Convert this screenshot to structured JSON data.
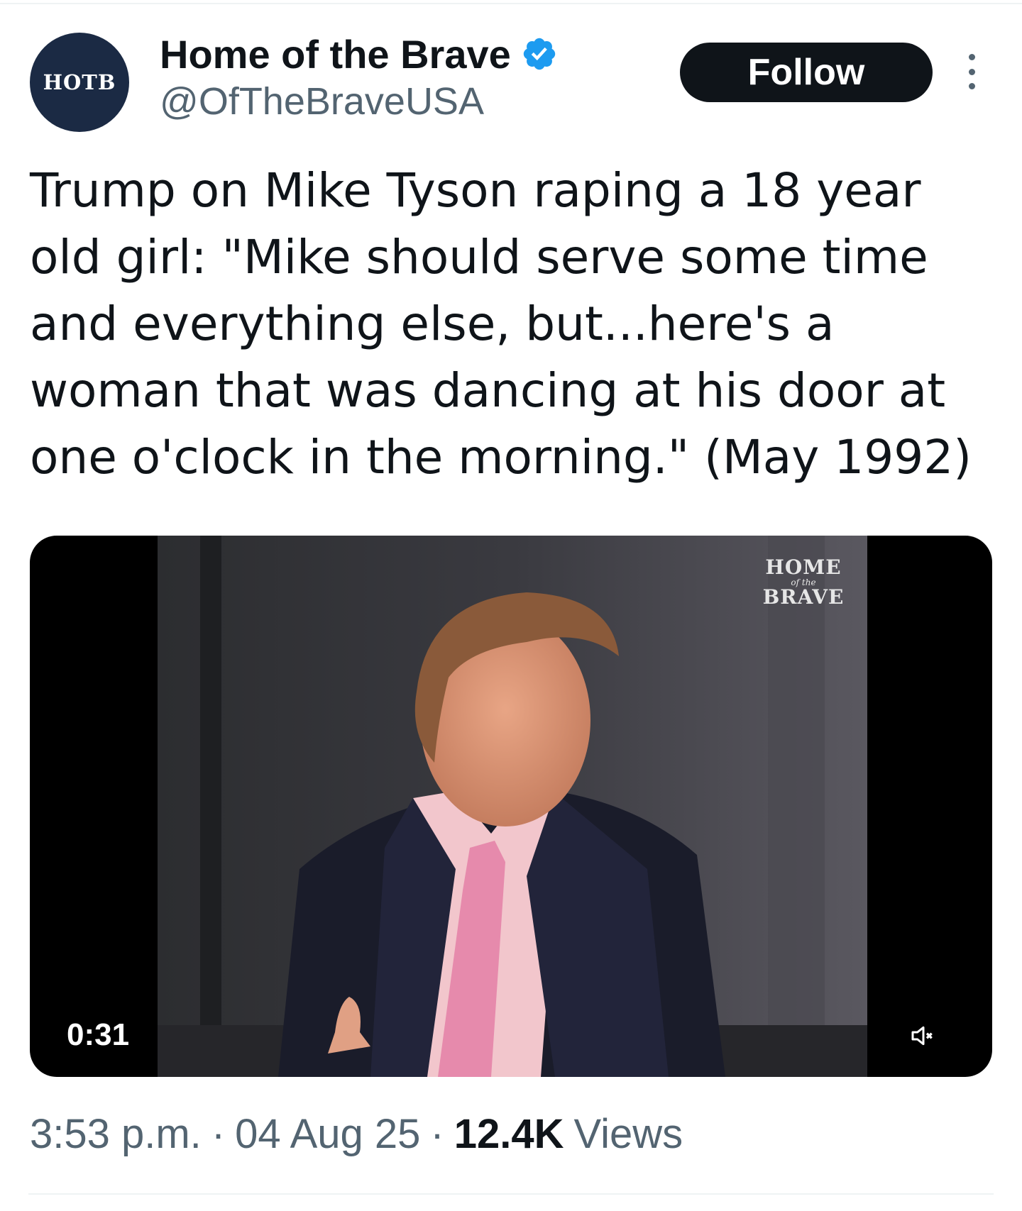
{
  "profile": {
    "avatar_text": "HOTB",
    "display_name": "Home of the Brave",
    "handle": "@OfTheBraveUSA",
    "verified_icon": "verified-badge-icon",
    "verified_color": "#1d9bf0"
  },
  "actions": {
    "follow_label": "Follow",
    "more_icon": "more-vertical-icon"
  },
  "tweet": {
    "text": "Trump on Mike Tyson raping a 18 year\nold girl: \"Mike should serve some time\nand everything else, but...here's a\nwoman that was dancing at his door at\none o'clock in the morning.\" (May 1992)"
  },
  "media": {
    "type": "video",
    "duration": "0:31",
    "mute_icon": "speaker-muted-icon",
    "watermark_top": "HOME",
    "watermark_mid": "of the",
    "watermark_bottom": "BRAVE"
  },
  "meta": {
    "time": "3:53 p.m.",
    "separator": "·",
    "date": "04 Aug 25",
    "views_count": "12.4K",
    "views_label": "Views"
  },
  "colors": {
    "text_primary": "#0f1419",
    "text_secondary": "#536471",
    "avatar_bg": "#1b2a44",
    "button_bg": "#0f1419"
  }
}
